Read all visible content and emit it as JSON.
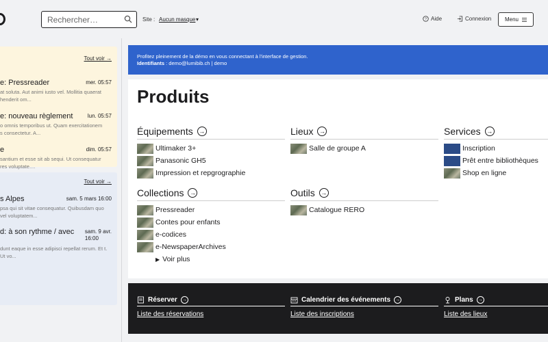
{
  "header": {
    "search_placeholder": "Rechercher…",
    "site_label": "Site :",
    "site_value": "Aucun masque",
    "site_caret": "▾",
    "help_label": "Aide",
    "login_label": "Connexion",
    "menu_label": "Menu"
  },
  "news": {
    "see_all": "Tout voir →",
    "items": [
      {
        "title": "e: Pressreader",
        "date": "mer. 05:57",
        "text": "at soluta. Aut animi iusto vel. Mollitia quaerat\nhenderit om..."
      },
      {
        "title": "e: nouveau règlement",
        "date": "lun. 05:57",
        "text": "o omnis temporibus ut. Quam exercitationem\ns consectetur. A..."
      },
      {
        "title": "e",
        "date": "dim. 05:57",
        "text": "santium et esse sit ab sequi. Ut consequatur\nres voluptate...."
      }
    ]
  },
  "events": {
    "see_all": "Tout voir →",
    "items": [
      {
        "title": "s Alpes",
        "date": "sam. 5 mars 16:00",
        "text": "psa qui sit vitae consequatur. Quibusdam quo\nvel voluptatem..."
      },
      {
        "title": "d: à son rythme / avec",
        "date_line1": "sam. 9 avr.",
        "date_line2": "16:00",
        "text": "dunt eaque in esse adipisci repellat rerum. Et\nt. Ut vo..."
      }
    ]
  },
  "banner": {
    "line1": "Profitez pleinement de la démo en vous connectant à l'interface de gestion.",
    "ident_label": "Identifiants",
    "ident_value": " : demo@lumibib.ch | demo"
  },
  "main": {
    "title": "Produits",
    "sections": {
      "equipements": {
        "title": "Équipements",
        "items": [
          "Ultimaker 3+",
          "Panasonic GH5",
          "Impression et repgrographie"
        ]
      },
      "lieux": {
        "title": "Lieux",
        "items": [
          "Salle de groupe A"
        ]
      },
      "services": {
        "title": "Services",
        "items": [
          "Inscription",
          "Prêt entre bibliothèques",
          "Shop en ligne"
        ]
      },
      "collections": {
        "title": "Collections",
        "items": [
          "Pressreader",
          "Contes pour enfants",
          "e-codices",
          "e-NewspaperArchives"
        ],
        "more": "Voir plus"
      },
      "outils": {
        "title": "Outils",
        "items": [
          "Catalogue RERO"
        ]
      }
    }
  },
  "footer_bar": {
    "reserver": {
      "title": "Réserver",
      "link": "Liste des réservations"
    },
    "calendrier": {
      "title": "Calendrier des événements",
      "link": "Liste des inscriptions"
    },
    "plans": {
      "title": "Plans",
      "link": "Liste des lieux"
    }
  }
}
